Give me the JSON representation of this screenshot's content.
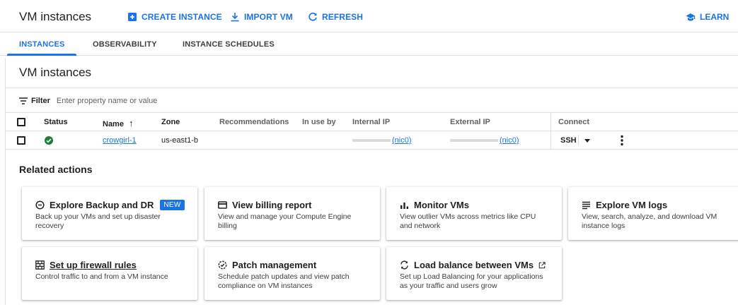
{
  "header": {
    "title": "VM instances",
    "create_label": "CREATE INSTANCE",
    "import_label": "IMPORT VM",
    "refresh_label": "REFRESH",
    "learn_label": "LEARN"
  },
  "tabs": [
    {
      "label": "INSTANCES",
      "active": true
    },
    {
      "label": "OBSERVABILITY",
      "active": false
    },
    {
      "label": "INSTANCE SCHEDULES",
      "active": false
    }
  ],
  "section": {
    "title": "VM instances"
  },
  "filter": {
    "label": "Filter",
    "placeholder": "Enter property name or value"
  },
  "table": {
    "headers": {
      "status": "Status",
      "name": "Name",
      "sort_arrow": "↑",
      "zone": "Zone",
      "recommendations": "Recommendations",
      "in_use_by": "In use by",
      "internal_ip": "Internal IP",
      "external_ip": "External IP",
      "connect": "Connect"
    },
    "rows": [
      {
        "status": "running",
        "name": "crowgirl-1",
        "zone": "us-east1-b",
        "recommendations": "",
        "in_use_by": "",
        "internal_ip_nic": "(nic0)",
        "external_ip_nic": "(nic0)",
        "connect": "SSH"
      }
    ]
  },
  "related": {
    "title": "Related actions",
    "cards": [
      {
        "icon": "backup-icon",
        "title": "Explore Backup and DR",
        "badge": "NEW",
        "desc": "Back up your VMs and set up disaster recovery"
      },
      {
        "icon": "billing-icon",
        "title": "View billing report",
        "desc": "View and manage your Compute Engine billing"
      },
      {
        "icon": "monitoring-icon",
        "title": "Monitor VMs",
        "desc": "View outlier VMs across metrics like CPU and network"
      },
      {
        "icon": "logs-icon",
        "title": "Explore VM logs",
        "desc": "View, search, analyze, and download VM instance logs"
      },
      {
        "icon": "firewall-icon",
        "title": "Set up firewall rules",
        "desc": "Control traffic to and from a VM instance"
      },
      {
        "icon": "patch-icon",
        "title": "Patch management",
        "desc": "Schedule patch updates and view patch compliance on VM instances"
      },
      {
        "icon": "load-balance-icon",
        "title": "Load balance between VMs",
        "desc": "Set up Load Balancing for your applications as your traffic and users grow"
      }
    ]
  },
  "colors": {
    "accent": "#1a73e8",
    "status_ok": "#188038"
  }
}
